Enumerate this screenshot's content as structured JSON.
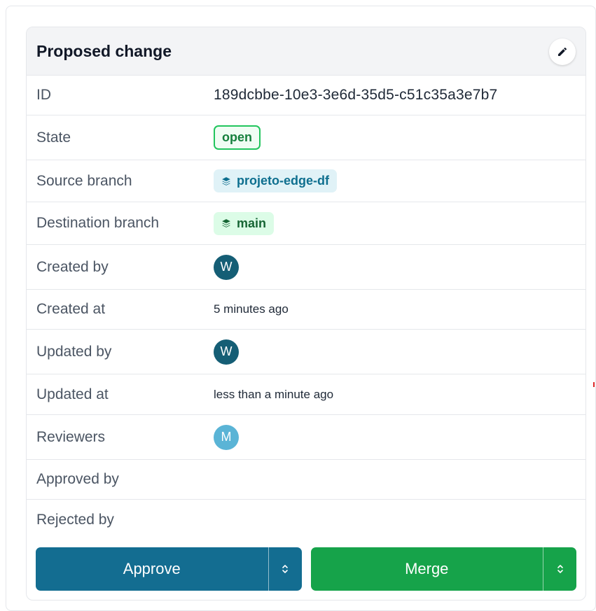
{
  "header": {
    "title": "Proposed change",
    "edit_icon": "pencil-icon"
  },
  "fields": {
    "id": {
      "label": "ID",
      "value": "189dcbbe-10e3-3e6d-35d5-c51c35a3e7b7"
    },
    "state": {
      "label": "State",
      "value": "open"
    },
    "source_branch": {
      "label": "Source branch",
      "value": "projeto-edge-df",
      "icon": "layers-icon"
    },
    "destination_branch": {
      "label": "Destination branch",
      "value": "main",
      "icon": "layers-icon"
    },
    "created_by": {
      "label": "Created by",
      "avatar": "W"
    },
    "created_at": {
      "label": "Created at",
      "value": "5 minutes ago"
    },
    "updated_by": {
      "label": "Updated by",
      "avatar": "W"
    },
    "updated_at": {
      "label": "Updated at",
      "value": "less than a minute ago"
    },
    "reviewers": {
      "label": "Reviewers",
      "avatar": "M"
    },
    "approved_by": {
      "label": "Approved by"
    },
    "rejected_by": {
      "label": "Rejected by"
    }
  },
  "actions": {
    "approve_label": "Approve",
    "merge_label": "Merge",
    "toggle_icon": "chevron-up-down-icon"
  },
  "colors": {
    "primary": "#136d91",
    "success": "#16a34a",
    "open_badge": "#22c55e",
    "avatar_dark": "#155e75",
    "avatar_light": "#5ab4d6"
  }
}
